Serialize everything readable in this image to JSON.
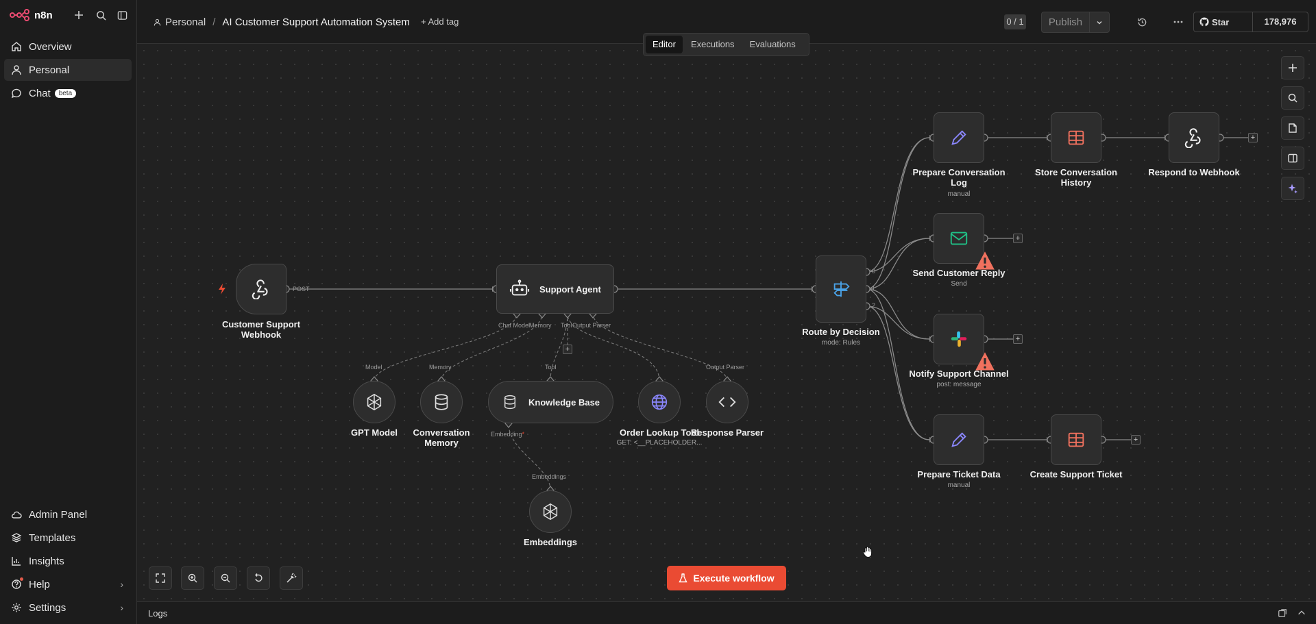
{
  "brand": {
    "name": "n8n"
  },
  "sidebar": {
    "top_items": [
      {
        "label": "Overview",
        "icon": "home-icon"
      },
      {
        "label": "Personal",
        "icon": "user-icon"
      },
      {
        "label": "Chat",
        "icon": "chat-icon",
        "badge": "beta"
      }
    ],
    "bottom_items": [
      {
        "label": "Admin Panel",
        "icon": "cloud-icon"
      },
      {
        "label": "Templates",
        "icon": "templates-icon"
      },
      {
        "label": "Insights",
        "icon": "chart-icon"
      },
      {
        "label": "Help",
        "icon": "help-icon"
      },
      {
        "label": "Settings",
        "icon": "gear-icon"
      }
    ]
  },
  "header": {
    "breadcrumb_project": "Personal",
    "separator": "/",
    "workflow_title": "AI Customer Support Automation System",
    "add_tag": "+ Add tag",
    "version_counter": "0 / 1",
    "publish_label": "Publish",
    "github_star": "Star",
    "github_count": "178,976"
  },
  "tabs": [
    {
      "label": "Editor",
      "active": true
    },
    {
      "label": "Executions",
      "active": false
    },
    {
      "label": "Evaluations",
      "active": false
    }
  ],
  "nodes": {
    "webhook": {
      "label1": "Customer Support",
      "label2": "Webhook",
      "port": "POST"
    },
    "agent": {
      "label": "Support Agent",
      "ports": [
        "Chat Model",
        "Memory",
        "Tool",
        "Output Parser"
      ]
    },
    "gpt": {
      "label": "GPT Model",
      "port": "Model"
    },
    "memory": {
      "label1": "Conversation",
      "label2": "Memory",
      "port": "Memory"
    },
    "kb": {
      "label": "Knowledge Base",
      "port": "Tool",
      "out_port": "Embedding"
    },
    "order": {
      "label": "Order Lookup Tool",
      "sub": "GET: <__PLACEHOLDER..."
    },
    "parser": {
      "label": "Response Parser",
      "port": "Output Parser"
    },
    "embeddings": {
      "label": "Embeddings",
      "port": "Embeddings"
    },
    "route": {
      "label": "Route by Decision",
      "sub": "mode: Rules",
      "outs": [
        "0",
        "1",
        "2"
      ]
    },
    "prep_log": {
      "label1": "Prepare Conversation",
      "label2": "Log",
      "sub": "manual"
    },
    "store": {
      "label1": "Store Conversation",
      "label2": "History"
    },
    "respond": {
      "label": "Respond to Webhook"
    },
    "reply": {
      "label": "Send Customer Reply",
      "sub": "Send"
    },
    "notify": {
      "label": "Notify Support Channel",
      "sub": "post: message"
    },
    "prep_ticket": {
      "label": "Prepare Ticket Data",
      "sub": "manual"
    },
    "ticket": {
      "label": "Create Support Ticket"
    }
  },
  "canvas": {
    "execute_label": "Execute workflow",
    "plus": "+"
  },
  "logs": {
    "title": "Logs"
  },
  "colors": {
    "accent": "#ea4b33",
    "edit": "#8b87ff",
    "table": "#f0715e",
    "mail": "#20c187",
    "route": "#4aa3e8"
  }
}
